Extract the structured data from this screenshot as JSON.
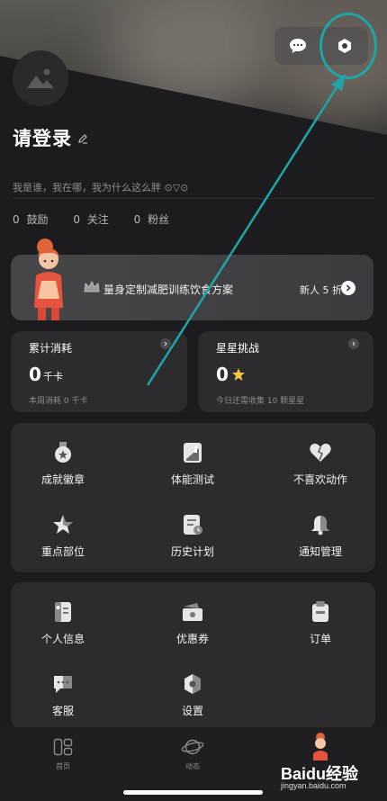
{
  "header": {
    "chat_icon": "chat-bubble-icon",
    "settings_icon": "settings-hex-icon"
  },
  "profile": {
    "login_text": "请登录",
    "bio": "我是谁，我在哪，我为什么这么胖 ⊙▽⊙",
    "stats": [
      {
        "count": "0",
        "label": "鼓励"
      },
      {
        "count": "0",
        "label": "关注"
      },
      {
        "count": "0",
        "label": "粉丝"
      }
    ]
  },
  "banner": {
    "text": "量身定制减肥训练饮食方案",
    "badge": "新人 5 折"
  },
  "cards": {
    "calories": {
      "title": "累计消耗",
      "value": "0",
      "unit": "千卡",
      "footer": "本周消耗 0 千卡"
    },
    "stars": {
      "title": "星星挑战",
      "value": "0",
      "footer": "今日还需收集 10 颗星星"
    }
  },
  "grid1": [
    {
      "label": "成就徽章",
      "icon": "medal-icon"
    },
    {
      "label": "体能测试",
      "icon": "fitness-test-icon"
    },
    {
      "label": "不喜欢动作",
      "icon": "broken-heart-icon"
    },
    {
      "label": "重点部位",
      "icon": "star-body-icon"
    },
    {
      "label": "历史计划",
      "icon": "history-plan-icon"
    },
    {
      "label": "通知管理",
      "icon": "bell-icon"
    }
  ],
  "grid2": [
    {
      "label": "个人信息",
      "icon": "profile-card-icon"
    },
    {
      "label": "优惠券",
      "icon": "coupon-icon"
    },
    {
      "label": "订单",
      "icon": "order-icon"
    },
    {
      "label": "客服",
      "icon": "customer-service-icon"
    },
    {
      "label": "设置",
      "icon": "settings-icon"
    }
  ],
  "bottom_nav": [
    {
      "label": "首页",
      "icon": "home-icon"
    },
    {
      "label": "动态",
      "icon": "planet-icon"
    },
    {
      "label": "",
      "icon": "avatar-figure-icon"
    }
  ],
  "watermark": {
    "brand": "Baidu经验",
    "url": "jingyan.baidu.com"
  },
  "colors": {
    "background": "#1c1c1e",
    "panel": "#2c2c2e",
    "highlight": "#1fa5a5",
    "star": "#f5c542"
  }
}
